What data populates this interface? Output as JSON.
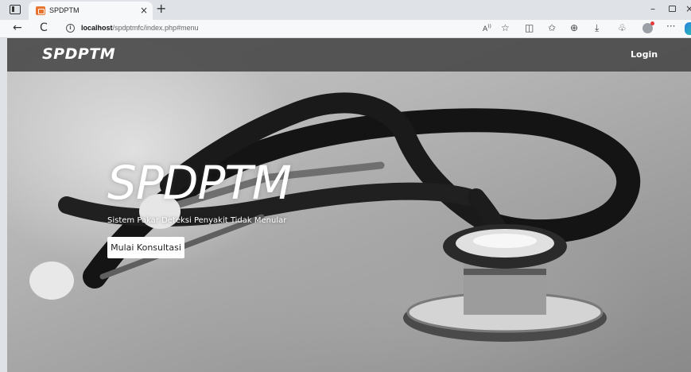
{
  "browser": {
    "tab_title": "SPDPTM",
    "tab_close": "×",
    "new_tab": "+",
    "url_host": "localhost",
    "url_path": "/spdptmfc/index.php#menu",
    "info_glyph": "i",
    "back_glyph": "←",
    "refresh_glyph": "C",
    "min_glyph": "–",
    "close_glyph": "×",
    "toolbar_icons": [
      "read-aloud-icon",
      "favorite-star-icon",
      "split-screen-icon",
      "favorites-icon",
      "collections-icon",
      "downloads-icon",
      "extensions-icon",
      "profile-icon",
      "more-icon",
      "copilot-icon"
    ]
  },
  "navbar": {
    "brand": "SPDPTM",
    "login": "Login"
  },
  "hero": {
    "title": "SPDPTM",
    "subtitle": "Sistem Pakar Deteksi Penyakit Tidak Menular",
    "cta": "Mulai Konsultasi"
  },
  "colors": {
    "navbar_bg": "#464646",
    "text_light": "#ffffff",
    "button_bg": "#ffffff"
  }
}
